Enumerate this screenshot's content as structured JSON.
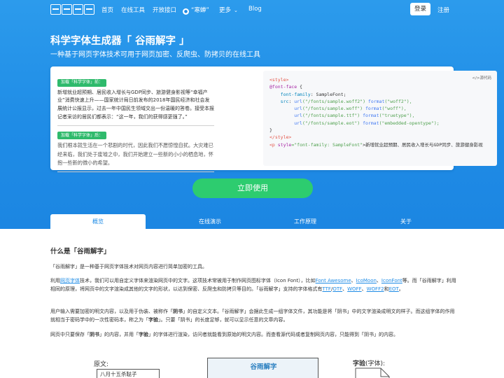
{
  "nav": {
    "items": [
      {
        "label": "首页"
      },
      {
        "label": "在线工具"
      },
      {
        "label": "开放接口"
      },
      {
        "label": "“寒蝉”"
      },
      {
        "label": "更多"
      },
      {
        "label": "Blog"
      }
    ],
    "login_label": "登录",
    "register_label": "注册"
  },
  "hero": {
    "title": "科学字体生成器「 谷雨解字 」",
    "subtitle": "一种基于网页字体技术可用于网页加密、反爬虫、防拷贝的在线工具"
  },
  "demo": {
    "tag1": "加载「科学字体」前：",
    "para1": "新增就业超预期、居民收入增长与GDP同步、旅游健身影视等“幸福产业”消费快速上升——国家统计局日前发布的2018年国民经济和社会发展统计公报显示，过去一年中国民生领域交出一份温暖的答卷。接受本报记者采访的居民们都表示：“这一年，我们的获得感更强了。”",
    "tag2": "加载「科学字体」后：",
    "para2": "我们根本就生活在一个悲剧的时代，因此我们不愿惊惶自扰。大灾难已经来临，我们处于废墟之中，我们开始建立一些新的小小的栖息地，怀抱一些新的微小的希望。",
    "code_label": "</>源代码",
    "code": {
      "l1": "<style>",
      "l2a": "@font-face",
      "l2b": " {",
      "l3a": "    font-family",
      "l3b": ": SampleFont;",
      "l4a": "    src",
      "l4b": ": ",
      "l4c": "url",
      "l4d": "(\"/fonts/sample.woff2\") ",
      "l4e": "format",
      "l4f": "(\"woff2\"),",
      "l5a": "url",
      "l5b": "(\"/fonts/sample.woff\") ",
      "l5c": "format",
      "l5d": "(\"woff\"),",
      "l6a": "url",
      "l6b": "(\"/fonts/sample.ttf\") ",
      "l6c": "format",
      "l6d": "(\"truetype\"),",
      "l7a": "url",
      "l7b": "(\"/fonts/sample.eot\") ",
      "l7c": "format",
      "l7d": "(\"embedded-opentype\");",
      "l8": "}",
      "l9": "</style>",
      "l10a": "<p ",
      "l10b": "style",
      "l10c": "=\"font-family: SampleFont\"",
      "l10d": ">新增就业超预期、居民收入增长与GDP同步、旅游健身影视"
    }
  },
  "cta": {
    "label": "立即使用"
  },
  "tabs": [
    {
      "label": "概览"
    },
    {
      "label": "在线演示"
    },
    {
      "label": "工作原理"
    },
    {
      "label": "关于"
    }
  ],
  "content": {
    "heading": "什么是「谷雨解字」",
    "p1": "「谷雨解字」是一种基于网页字体技术对网页内容进行简单加密的工具。",
    "p2": {
      "t1": "利用",
      "link_webfont": "网页字体",
      "t2": "技术，我们可以用自定义字体来渲染网页中的文字。这项技术常被用于制作网页图标字体（Icon Font），比如",
      "link_fa": "Font Awesome",
      "t3": "、",
      "link_icomoon": "IcoMoon",
      "t4": "、",
      "link_iconfont": "IconFont",
      "t5": "等。而「谷雨解字」利用相同的原理，将网页中的文字渲染成其他的文字的形状，以达到保密、反爬虫和防拷贝等目的。「谷雨解字」支持的字体格式有",
      "link_ttf": "TTF",
      "t6": "/",
      "link_otf": "OTF",
      "t7": "、",
      "link_woff": "WOFF",
      "t8": "、",
      "link_woff2": "WOFF2",
      "t9": "和",
      "link_eot": "EOT",
      "t10": "。"
    },
    "p3": {
      "t1": "用户输入需要加密的明文内容，以及用于伪装、被称作「",
      "b1": "阴书",
      "t2": "」的自定义文本。「谷雨解字」会据此生成一组字体文件，其功能是将「阴书」中的文字渲染成明文的样子。而这组字体的作用就相当于密码学中的一次性密码本，称之为「",
      "b2": "字验",
      "t3": "」。只要「阴书」的长度足够，就可以显示任意的文章内容。"
    },
    "p4": {
      "t1": "网页中只要保存「",
      "b1": "阴书",
      "t2": "」的内容，并用「",
      "b2": "字验",
      "t3": "」的字体进行渲染，访问者就能看到原始的明文内容。而查看源代码或者复制网页内容，只能得到「阴书」的内容。"
    }
  },
  "diagram": {
    "plain_label": "原文:",
    "plain_text": "八月十五杀鞑子",
    "center_title": "谷雨解字",
    "right_label_a": "字验",
    "right_label_b": "(字体):"
  }
}
